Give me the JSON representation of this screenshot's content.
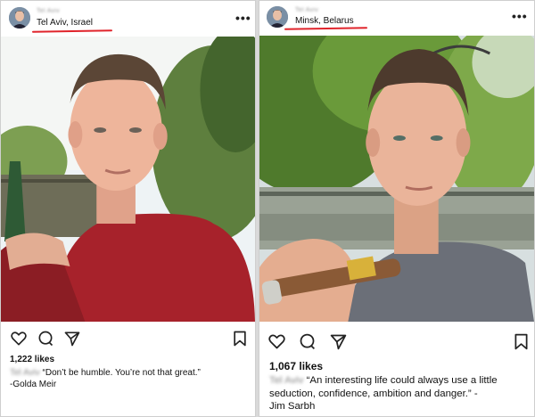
{
  "posts": [
    {
      "username": "Tel Aviv",
      "location": "Tel Aviv, Israel",
      "likes": "1,222 likes",
      "caption_user": "Tel Aviv",
      "caption_text": "“Don’t be humble. You’re not that great.”",
      "caption_author": "-Golda Meir",
      "more_icon": "•••"
    },
    {
      "username": "Tel Aviv",
      "location": "Minsk, Belarus",
      "likes": "1,067 likes",
      "caption_user": "Tel Aviv",
      "caption_text": "“An interesting life could always use a little seduction, confidence, ambition and danger.” -",
      "caption_author": "Jim Sarbh",
      "more_icon": "•••"
    }
  ],
  "icons": {
    "like": "heart-icon",
    "comment": "comment-icon",
    "share": "share-icon",
    "save": "bookmark-icon",
    "more": "more-icon"
  },
  "colors": {
    "location_underline": "#e0242b",
    "background": "#d9d9d9"
  }
}
